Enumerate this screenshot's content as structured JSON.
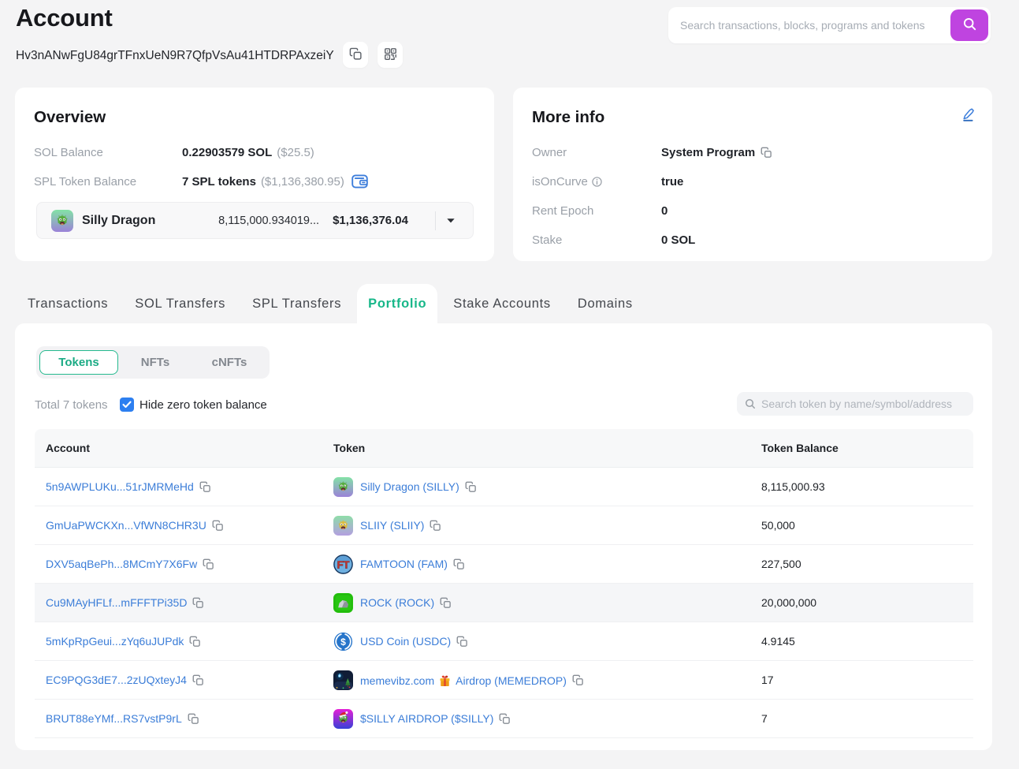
{
  "page": {
    "title": "Account"
  },
  "header_search": {
    "placeholder": "Search transactions, blocks, programs and tokens"
  },
  "account": {
    "address": "Hv3nANwFgU84grTFnxUeN9R7QfpVsAu41HTDRPAxzeiY"
  },
  "overview": {
    "title": "Overview",
    "sol_balance": {
      "label": "SOL Balance",
      "value": "0.22903579 SOL",
      "usd": "($25.5)"
    },
    "spl_balance": {
      "label": "SPL Token Balance",
      "value": "7 SPL tokens",
      "usd": "($1,136,380.95)"
    },
    "token_selector": {
      "name": "Silly Dragon",
      "amount": "8,115,000.934019...",
      "usd": "$1,136,376.04",
      "icon": "silly_dragon"
    }
  },
  "more_info": {
    "title": "More info",
    "owner": {
      "label": "Owner",
      "value": "System Program"
    },
    "is_on_curve": {
      "label": "isOnCurve",
      "value": "true"
    },
    "rent_epoch": {
      "label": "Rent Epoch",
      "value": "0"
    },
    "stake": {
      "label": "Stake",
      "value": "0 SOL"
    }
  },
  "tabs": [
    {
      "label": "Transactions",
      "active": false
    },
    {
      "label": "SOL Transfers",
      "active": false
    },
    {
      "label": "SPL Transfers",
      "active": false
    },
    {
      "label": "Portfolio",
      "active": true
    },
    {
      "label": "Stake Accounts",
      "active": false
    },
    {
      "label": "Domains",
      "active": false
    }
  ],
  "portfolio": {
    "subtabs": [
      {
        "label": "Tokens",
        "active": true
      },
      {
        "label": "NFTs",
        "active": false
      },
      {
        "label": "cNFTs",
        "active": false
      }
    ],
    "total_label": "Total 7 tokens",
    "hide_zero_label": "Hide zero token balance",
    "hide_zero_checked": true,
    "search_placeholder": "Search token by name/symbol/address",
    "table": {
      "columns": [
        "Account",
        "Token",
        "Token Balance"
      ],
      "rows": [
        {
          "account": "5n9AWPLUKu...51rJMRMeHd",
          "token": "Silly Dragon (SILLY)",
          "icon": "silly_dragon",
          "balance": "8,115,000.93",
          "highlight": false
        },
        {
          "account": "GmUaPWCKXn...VfWN8CHR3U",
          "token": "SLIIY (SLIIY)",
          "icon": "sliiy",
          "balance": "50,000",
          "highlight": false
        },
        {
          "account": "DXV5aqBePh...8MCmY7X6Fw",
          "token": "FAMTOON (FAM)",
          "icon": "famtoon",
          "balance": "227,500",
          "highlight": false
        },
        {
          "account": "Cu9MAyHFLf...mFFFTPi35D",
          "token": "ROCK (ROCK)",
          "icon": "rock",
          "balance": "20,000,000",
          "highlight": true
        },
        {
          "account": "5mKpRpGeui...zYq6uJUPdk",
          "token": "USD Coin (USDC)",
          "icon": "usdc",
          "balance": "4.9145",
          "highlight": false
        },
        {
          "account": "EC9PQG3dE7...2zUQxteyJ4",
          "token": "memevibz.com",
          "token_after_gift": "Airdrop (MEMEDROP)",
          "has_gift_icon": true,
          "icon": "memevibz",
          "balance": "17",
          "highlight": false
        },
        {
          "account": "BRUT88eYMf...RS7vstP9rL",
          "token": "$SILLY AIRDROP ($SILLY)",
          "icon": "silly_airdrop",
          "balance": "7",
          "highlight": false
        }
      ]
    }
  },
  "colors": {
    "accent_teal": "#17b789",
    "accent_purple": "#bf44e0",
    "link_blue": "#3b7dd8",
    "checkbox_blue": "#2d7ff0",
    "page_bg": "#f4f4f5"
  }
}
